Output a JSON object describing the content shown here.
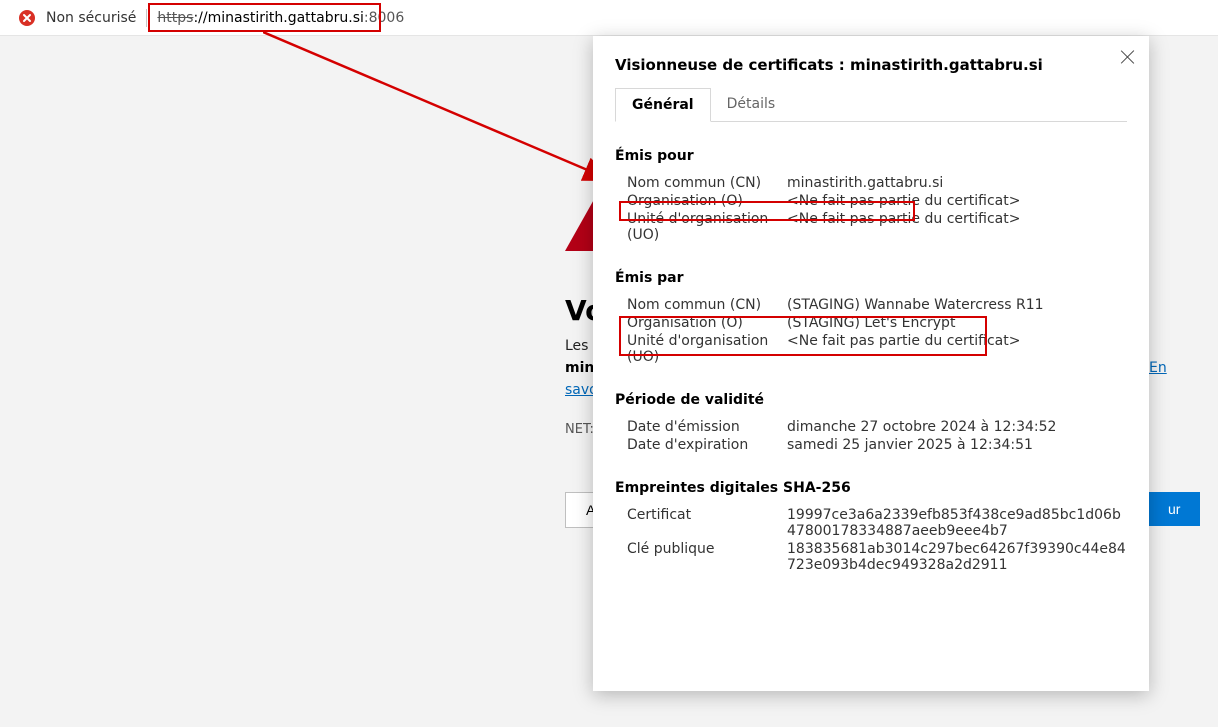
{
  "address_bar": {
    "security_label": "Non sécurisé",
    "scheme": "https",
    "host": "://minastirith.gattabru.si",
    "port": ":8006"
  },
  "warning_page": {
    "heading_fragment": "Vo",
    "line1": "Les u",
    "line2": "mina",
    "more_link_a": "En",
    "more_link_b": "savo",
    "net_prefix": "NET::",
    "advanced_btn": "Av",
    "return_btn": "ur"
  },
  "cert_viewer": {
    "title_prefix": "Visionneuse de certificats : ",
    "title_host": "minastirith.gattabru.si",
    "tabs": {
      "general": "Général",
      "details": "Détails"
    },
    "issued_to": {
      "heading": "Émis pour",
      "cn_label": "Nom commun (CN)",
      "cn_value": "minastirith.gattabru.si",
      "o_label": "Organisation (O)",
      "o_value": "<Ne fait pas partie du certificat>",
      "ou_label": "Unité d'organisation (UO)",
      "ou_value": "<Ne fait pas partie du certificat>"
    },
    "issued_by": {
      "heading": "Émis par",
      "cn_label": "Nom commun (CN)",
      "cn_value": "(STAGING) Wannabe Watercress R11",
      "o_label": "Organisation (O)",
      "o_value": "(STAGING) Let's Encrypt",
      "ou_label": "Unité d'organisation (UO)",
      "ou_value": "<Ne fait pas partie du certificat>"
    },
    "validity": {
      "heading": "Période de validité",
      "issued_label": "Date d'émission",
      "issued_value": "dimanche 27 octobre 2024 à 12:34:52",
      "expires_label": "Date d'expiration",
      "expires_value": "samedi 25 janvier 2025 à 12:34:51"
    },
    "fingerprints": {
      "heading": "Empreintes digitales SHA-256",
      "cert_label": "Certificat",
      "cert_value": "19997ce3a6a2339efb853f438ce9ad85bc1d06b47800178334887aeeb9eee4b7",
      "pubkey_label": "Clé publique",
      "pubkey_value": "183835681ab3014c297bec64267f39390c44e84723e093b4dec949328a2d2911"
    }
  }
}
